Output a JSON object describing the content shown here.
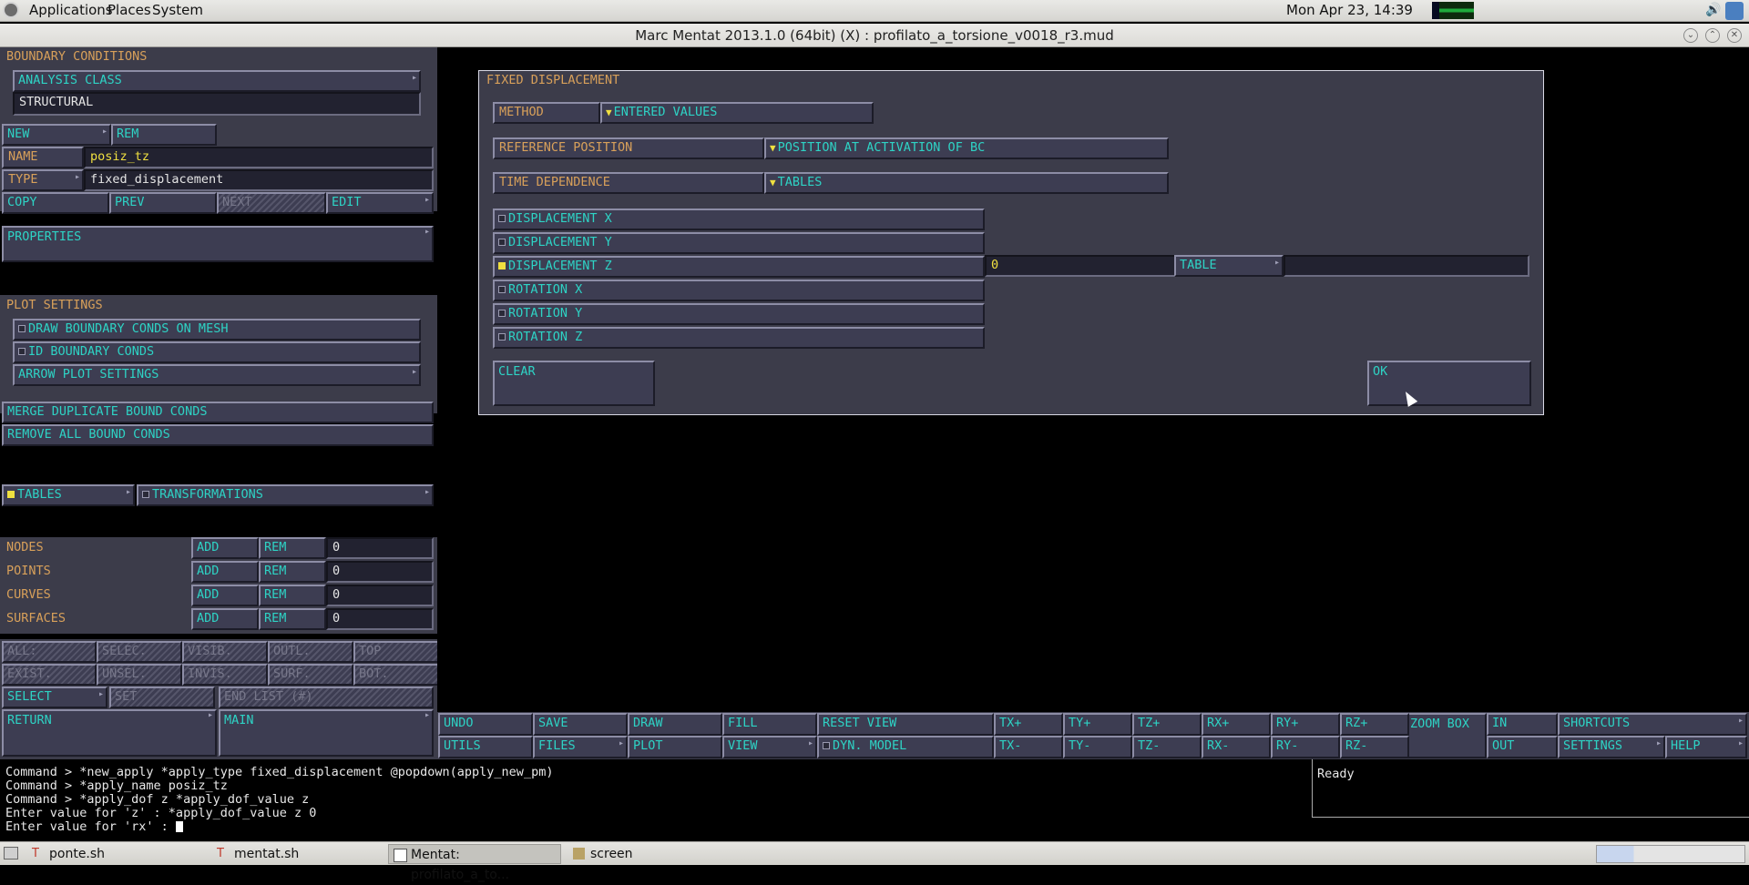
{
  "top_panel": {
    "menus": [
      "Applications",
      "Places",
      "System"
    ],
    "clock": "Mon Apr 23, 14:39"
  },
  "window": {
    "title": "Marc Mentat 2013.1.0 (64bit) (X) : profilato_a_torsione_v0018_r3.mud"
  },
  "left": {
    "boundary_header": "BOUNDARY CONDITIONS",
    "analysis_class_label": "ANALYSIS CLASS",
    "analysis_class_value": "STRUCTURAL",
    "new_label": "NEW",
    "rem_label": "REM",
    "name_label": "NAME",
    "name_value": "posiz_tz",
    "type_label": "TYPE",
    "type_value": "fixed_displacement",
    "copy_label": "COPY",
    "prev_label": "PREV",
    "next_label": "NEXT",
    "edit_label": "EDIT",
    "properties_label": "PROPERTIES",
    "plot_settings_header": "PLOT SETTINGS",
    "draw_bc_label": "DRAW BOUNDARY CONDS ON MESH",
    "id_bc_label": "ID BOUNDARY CONDS",
    "arrow_plot_label": "ARROW PLOT SETTINGS",
    "merge_label": "MERGE DUPLICATE BOUND CONDS",
    "remove_all_label": "REMOVE ALL BOUND CONDS",
    "tables_label": "TABLES",
    "transformations_label": "TRANSFORMATIONS",
    "entities": [
      {
        "label": "NODES",
        "add": "ADD",
        "rem": "REM",
        "count": "0"
      },
      {
        "label": "POINTS",
        "add": "ADD",
        "rem": "REM",
        "count": "0"
      },
      {
        "label": "CURVES",
        "add": "ADD",
        "rem": "REM",
        "count": "0"
      },
      {
        "label": "SURFACES",
        "add": "ADD",
        "rem": "REM",
        "count": "0"
      }
    ],
    "select_row1": [
      "ALL:",
      "SELEC.",
      "VISIB.",
      "OUTL.",
      "TOP"
    ],
    "select_row2": [
      "EXIST.",
      "UNSEL.",
      "INVIS.",
      "SURF.",
      "BOT."
    ],
    "select_label": "SELECT",
    "set_label": "SET",
    "end_list_label": "END LIST (#)",
    "return_label": "RETURN",
    "main_label": "MAIN"
  },
  "dialog": {
    "title": "FIXED DISPLACEMENT",
    "method_label": "METHOD",
    "method_value": "ENTERED VALUES",
    "ref_pos_label": "REFERENCE POSITION",
    "ref_pos_value": "POSITION AT ACTIVATION OF BC",
    "time_dep_label": "TIME DEPENDENCE",
    "time_dep_value": "TABLES",
    "dofs": [
      {
        "label": "DISPLACEMENT X",
        "checked": false
      },
      {
        "label": "DISPLACEMENT Y",
        "checked": false
      },
      {
        "label": "DISPLACEMENT Z",
        "checked": true
      },
      {
        "label": "ROTATION X",
        "checked": false
      },
      {
        "label": "ROTATION Y",
        "checked": false
      },
      {
        "label": "ROTATION Z",
        "checked": false
      }
    ],
    "dz_value": "0",
    "table_label": "TABLE",
    "table_value": "",
    "clear_label": "CLEAR",
    "ok_label": "OK"
  },
  "toolbar": {
    "row1": [
      "UNDO",
      "SAVE",
      "DRAW",
      "FILL",
      "RESET VIEW",
      "TX+",
      "TY+",
      "TZ+",
      "RX+",
      "RY+",
      "RZ+"
    ],
    "row2": [
      "UTILS",
      "FILES",
      "PLOT",
      "VIEW",
      "DYN. MODEL",
      "TX-",
      "TY-",
      "TZ-",
      "RX-",
      "RY-",
      "RZ-"
    ],
    "zoom_box": "ZOOM BOX",
    "in": "IN",
    "out": "OUT",
    "shortcuts": "SHORTCUTS",
    "settings": "SETTINGS",
    "help": "HELP"
  },
  "console": {
    "lines": [
      "Command > *new_apply *apply_type fixed_displacement @popdown(apply_new_pm)",
      "Command > *apply_name posiz_tz",
      "Command > *apply_dof z *apply_dof_value z",
      "Enter value for 'z' : *apply_dof_value z 0",
      "Enter value for 'rx' : "
    ],
    "status": "Ready"
  },
  "taskbar": {
    "tasks": [
      "ponte.sh",
      "mentat.sh",
      "Mentat: profilato_a_to...",
      "screen"
    ]
  }
}
